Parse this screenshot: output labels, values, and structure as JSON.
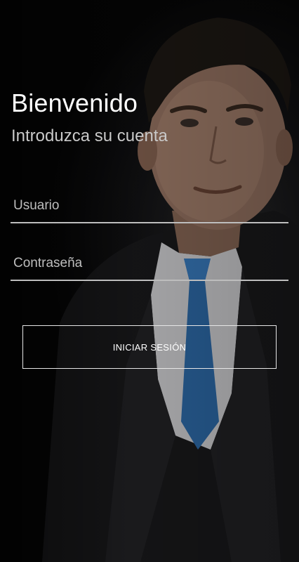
{
  "login": {
    "title": "Bienvenido",
    "subtitle": "Introduzca su cuenta",
    "username_placeholder": "Usuario",
    "password_placeholder": "Contraseña",
    "submit_label": "INICIAR SESIÓN"
  },
  "colors": {
    "background": "#050505",
    "text": "#ffffff",
    "subtitle_text": "#c9c9c9",
    "underline": "#bdbdbd",
    "button_border": "#e6e6e6",
    "tie": "#2f6fb0"
  }
}
